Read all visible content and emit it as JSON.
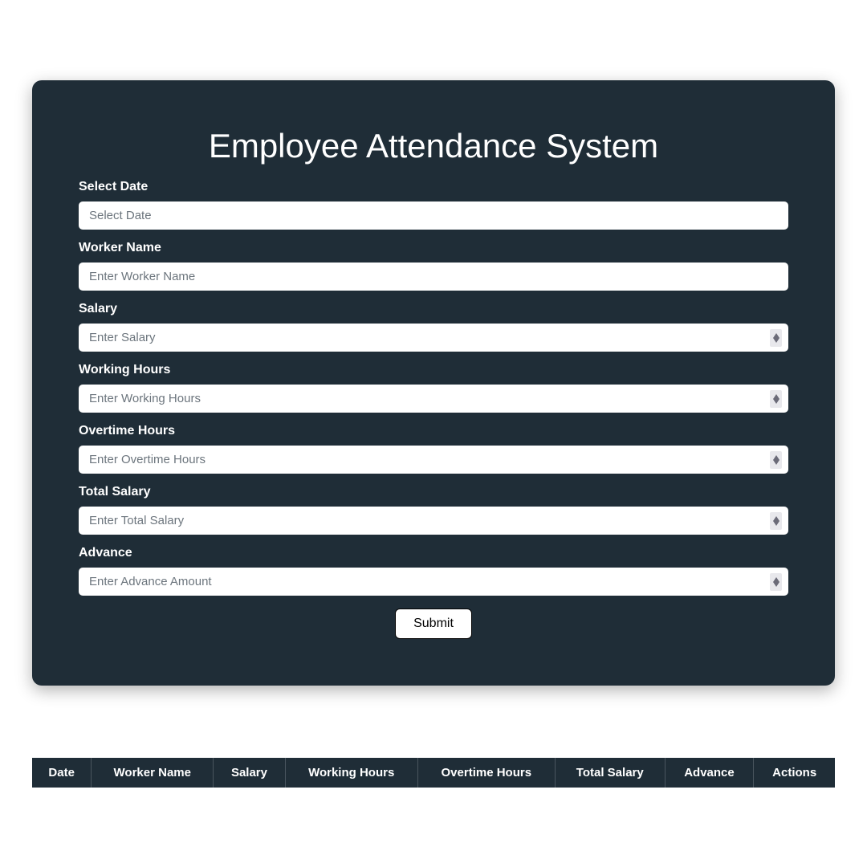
{
  "header": {
    "title": "Employee Attendance System"
  },
  "form": {
    "date": {
      "label": "Select Date",
      "placeholder": "Select Date"
    },
    "worker": {
      "label": "Worker Name",
      "placeholder": "Enter Worker Name"
    },
    "salary": {
      "label": "Salary",
      "placeholder": "Enter Salary"
    },
    "hours": {
      "label": "Working Hours",
      "placeholder": "Enter Working Hours"
    },
    "overtime": {
      "label": "Overtime Hours",
      "placeholder": "Enter Overtime Hours"
    },
    "total": {
      "label": "Total Salary",
      "placeholder": "Enter Total Salary"
    },
    "advance": {
      "label": "Advance",
      "placeholder": "Enter Advance Amount"
    },
    "submit": "Submit"
  },
  "table": {
    "headers": {
      "date": "Date",
      "worker": "Worker Name",
      "salary": "Salary",
      "hours": "Working Hours",
      "overtime": "Overtime Hours",
      "total": "Total Salary",
      "advance": "Advance",
      "actions": "Actions"
    }
  }
}
